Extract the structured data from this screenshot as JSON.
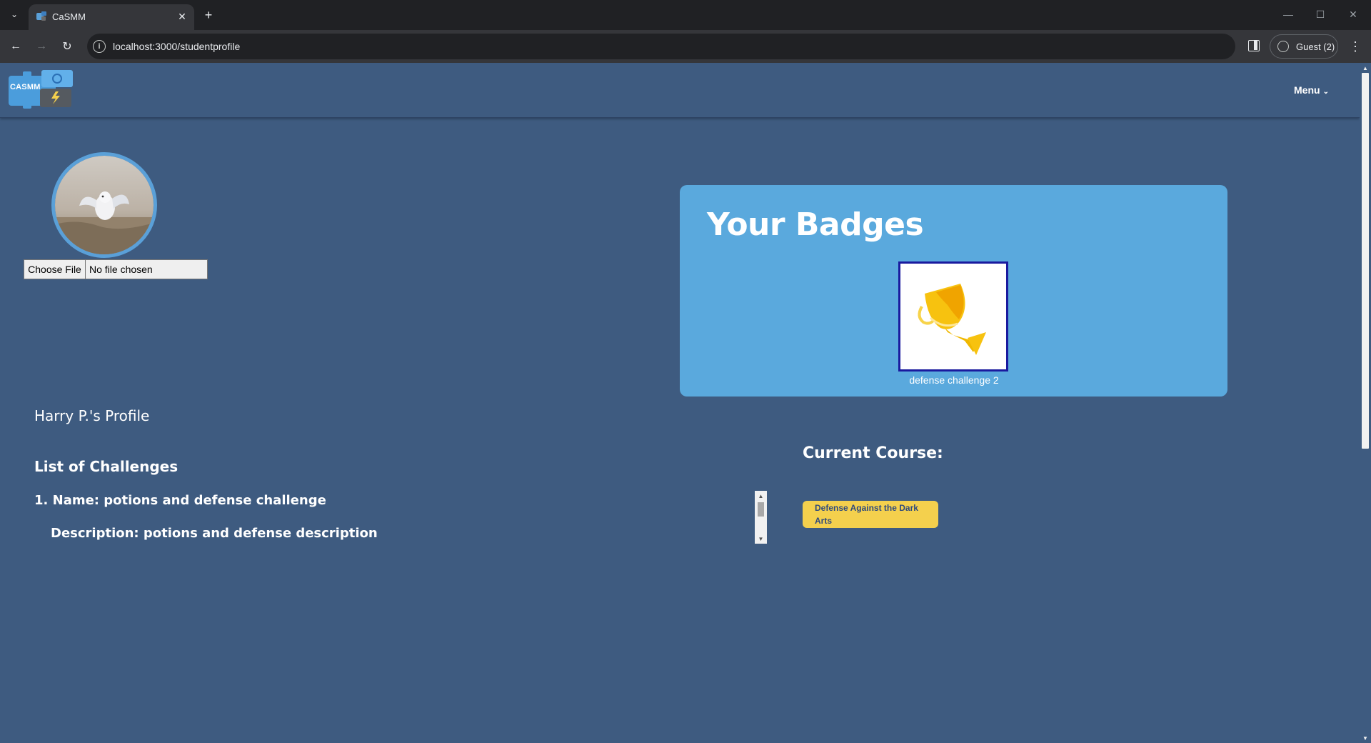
{
  "browser": {
    "tab_title": "CaSMM",
    "url": "localhost:3000/studentprofile",
    "profile_label": "Guest (2)"
  },
  "navbar": {
    "logo_text": "CASMM",
    "menu_label": "Menu"
  },
  "profile": {
    "file_button": "Choose File",
    "file_status": "No file chosen",
    "profile_title": "Harry P.'s Profile",
    "challenges_title": "List of Challenges",
    "challenges": [
      {
        "name": "1. Name: potions and defense challenge",
        "description": "Description: potions and defense description"
      }
    ]
  },
  "badges": {
    "title": "Your Badges",
    "items": [
      {
        "label": "defense challenge 2",
        "icon": "trophy-icon"
      }
    ]
  },
  "course": {
    "title": "Current Course:",
    "name": "Defense Against the Dark Arts"
  },
  "colors": {
    "page_bg": "#3e5b80",
    "card_bg": "#5aa9dd",
    "course_pill": "#f4d04d",
    "badge_border": "#1a1a9e"
  }
}
